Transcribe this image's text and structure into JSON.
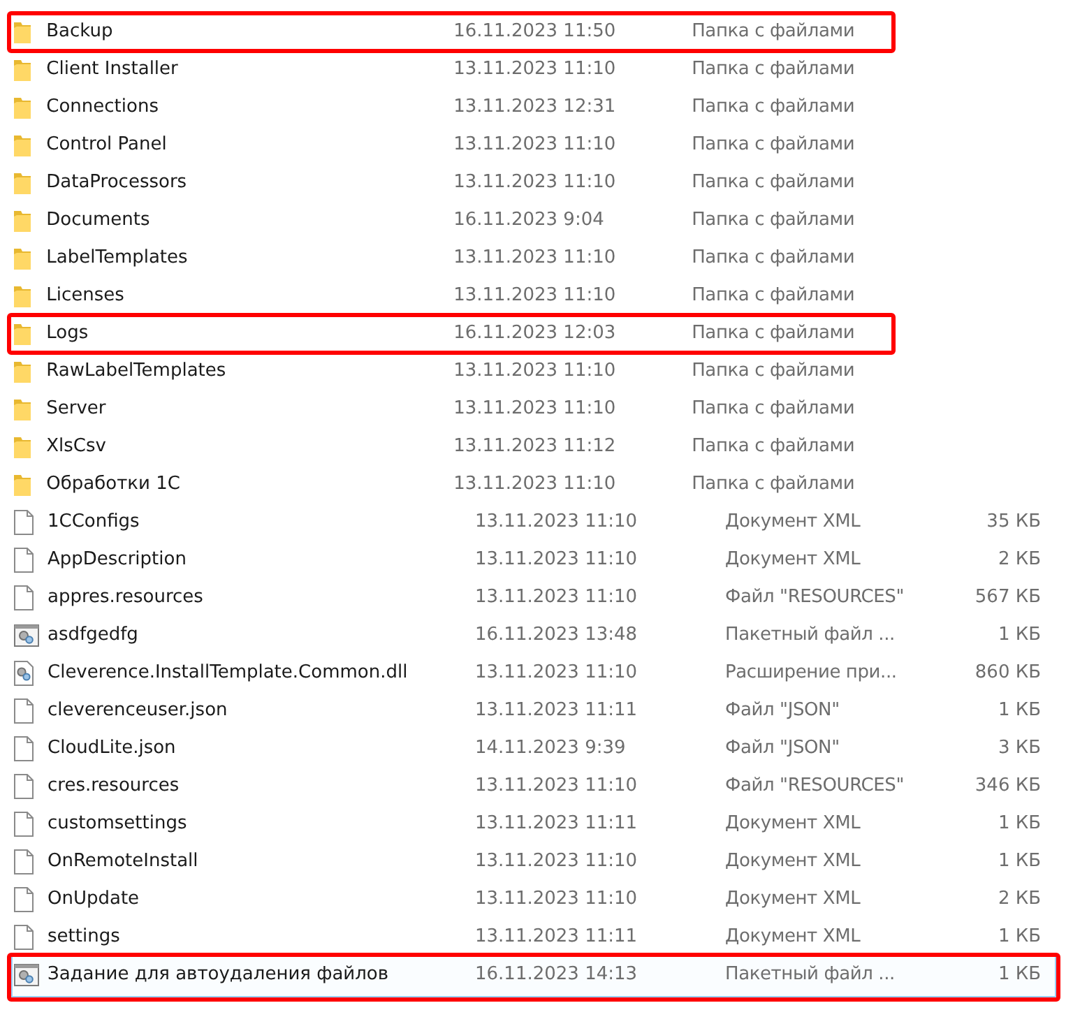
{
  "rows": [
    {
      "kind": "folder",
      "name": "Backup",
      "date": "16.11.2023 11:50",
      "type": "Папка с файлами",
      "highlighted": true,
      "selected": false
    },
    {
      "kind": "folder",
      "name": "Client Installer",
      "date": "13.11.2023 11:10",
      "type": "Папка с файлами",
      "highlighted": false,
      "selected": false
    },
    {
      "kind": "folder",
      "name": "Connections",
      "date": "13.11.2023 12:31",
      "type": "Папка с файлами",
      "highlighted": false,
      "selected": false
    },
    {
      "kind": "folder",
      "name": "Control Panel",
      "date": "13.11.2023 11:10",
      "type": "Папка с файлами",
      "highlighted": false,
      "selected": false
    },
    {
      "kind": "folder",
      "name": "DataProcessors",
      "date": "13.11.2023 11:10",
      "type": "Папка с файлами",
      "highlighted": false,
      "selected": false
    },
    {
      "kind": "folder",
      "name": "Documents",
      "date": "16.11.2023 9:04",
      "type": "Папка с файлами",
      "highlighted": false,
      "selected": false
    },
    {
      "kind": "folder",
      "name": "LabelTemplates",
      "date": "13.11.2023 11:10",
      "type": "Папка с файлами",
      "highlighted": false,
      "selected": false
    },
    {
      "kind": "folder",
      "name": "Licenses",
      "date": "13.11.2023 11:10",
      "type": "Папка с файлами",
      "highlighted": false,
      "selected": false
    },
    {
      "kind": "folder",
      "name": "Logs",
      "date": "16.11.2023 12:03",
      "type": "Папка с файлами",
      "highlighted": true,
      "selected": false
    },
    {
      "kind": "folder",
      "name": "RawLabelTemplates",
      "date": "13.11.2023 11:10",
      "type": "Папка с файлами",
      "highlighted": false,
      "selected": false
    },
    {
      "kind": "folder",
      "name": "Server",
      "date": "13.11.2023 11:10",
      "type": "Папка с файлами",
      "highlighted": false,
      "selected": false
    },
    {
      "kind": "folder",
      "name": "XlsCsv",
      "date": "13.11.2023 11:12",
      "type": "Папка с файлами",
      "highlighted": false,
      "selected": false
    },
    {
      "kind": "folder",
      "name": "Обработки 1С",
      "date": "13.11.2023 11:10",
      "type": "Папка с файлами",
      "highlighted": false,
      "selected": false
    },
    {
      "kind": "file",
      "name": "1CConfigs",
      "date": "13.11.2023 11:10",
      "type": "Документ XML",
      "size": "35 КБ",
      "highlighted": false,
      "selected": false
    },
    {
      "kind": "file",
      "name": "AppDescription",
      "date": "13.11.2023 11:10",
      "type": "Документ XML",
      "size": "2 КБ",
      "highlighted": false,
      "selected": false
    },
    {
      "kind": "file",
      "name": "appres.resources",
      "date": "13.11.2023 11:10",
      "type": "Файл \"RESOURCES\"",
      "size": "567 КБ",
      "highlighted": false,
      "selected": false
    },
    {
      "kind": "batch",
      "name": "asdfgedfg",
      "date": "16.11.2023 13:48",
      "type": "Пакетный файл ...",
      "size": "1 КБ",
      "highlighted": false,
      "selected": false
    },
    {
      "kind": "dll",
      "name": "Cleverence.InstallTemplate.Common.dll",
      "date": "13.11.2023 11:10",
      "type": "Расширение при...",
      "size": "860 КБ",
      "highlighted": false,
      "selected": false
    },
    {
      "kind": "file",
      "name": "cleverenceuser.json",
      "date": "13.11.2023 11:11",
      "type": "Файл \"JSON\"",
      "size": "1 КБ",
      "highlighted": false,
      "selected": false
    },
    {
      "kind": "file",
      "name": "CloudLite.json",
      "date": "14.11.2023 9:39",
      "type": "Файл \"JSON\"",
      "size": "3 КБ",
      "highlighted": false,
      "selected": false
    },
    {
      "kind": "file",
      "name": "cres.resources",
      "date": "13.11.2023 11:10",
      "type": "Файл \"RESOURCES\"",
      "size": "346 КБ",
      "highlighted": false,
      "selected": false
    },
    {
      "kind": "file",
      "name": "customsettings",
      "date": "13.11.2023 11:11",
      "type": "Документ XML",
      "size": "1 КБ",
      "highlighted": false,
      "selected": false
    },
    {
      "kind": "file",
      "name": "OnRemoteInstall",
      "date": "13.11.2023 11:10",
      "type": "Документ XML",
      "size": "1 КБ",
      "highlighted": false,
      "selected": false
    },
    {
      "kind": "file",
      "name": "OnUpdate",
      "date": "13.11.2023 11:10",
      "type": "Документ XML",
      "size": "2 КБ",
      "highlighted": false,
      "selected": false
    },
    {
      "kind": "file",
      "name": "settings",
      "date": "13.11.2023 11:11",
      "type": "Документ XML",
      "size": "1 КБ",
      "highlighted": false,
      "selected": false
    },
    {
      "kind": "batch",
      "name": "Задание для автоудаления файлов",
      "date": "16.11.2023 14:13",
      "type": "Пакетный файл ...",
      "size": "1 КБ",
      "highlighted": true,
      "selected": true
    }
  ]
}
